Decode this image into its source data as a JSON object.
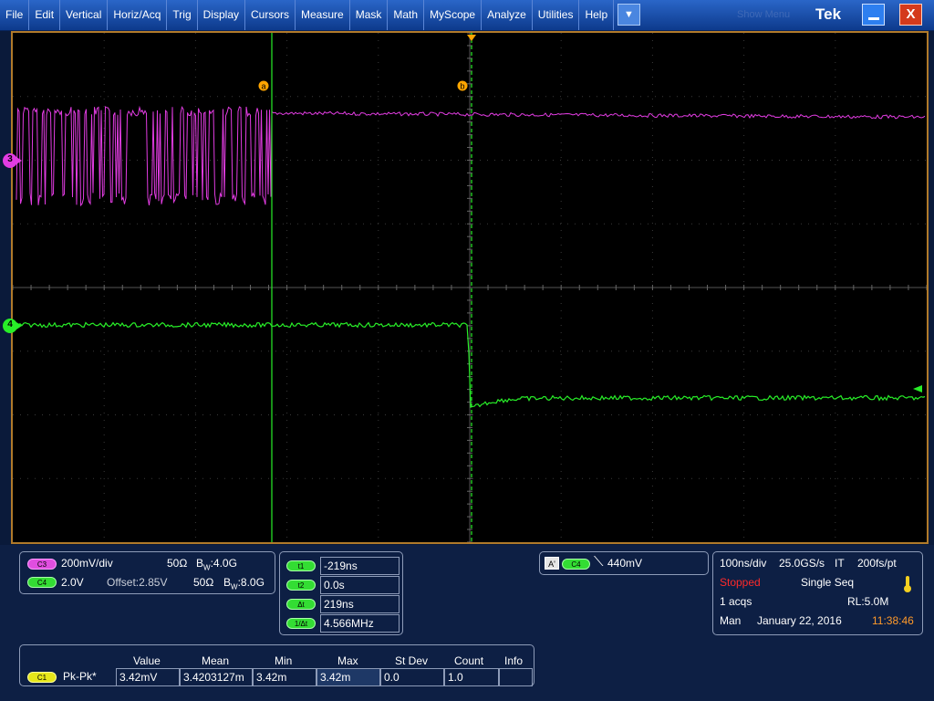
{
  "menu": [
    "File",
    "Edit",
    "Vertical",
    "Horiz/Acq",
    "Trig",
    "Display",
    "Cursors",
    "Measure",
    "Mask",
    "Math",
    "MyScope",
    "Analyze",
    "Utilities",
    "Help"
  ],
  "title": {
    "dropdown_glyph": "▼",
    "ghost": "Show Menu",
    "brand": "Tek",
    "minimize_glyph": "_",
    "close_glyph": "X"
  },
  "markers": {
    "ch3": "3",
    "ch4": "4",
    "cursor_a": "a",
    "cursor_b": "b"
  },
  "channels": {
    "ch3": {
      "tag": "C3",
      "scale": "200mV/div",
      "impedance": "50Ω",
      "bw_prefix": "B",
      "bw_sub": "W",
      "bw_value": ":4.0G",
      "color": "#e23ce2"
    },
    "ch4": {
      "tag": "C4",
      "scale": "2.0V",
      "offset": "Offset:2.85V",
      "impedance": "50Ω",
      "bw_prefix": "B",
      "bw_sub": "W",
      "bw_value": ":8.0G",
      "color": "#28ee28"
    }
  },
  "cursors": {
    "rows": [
      {
        "tag": "t1",
        "value": "-219ns"
      },
      {
        "tag": "t2",
        "value": "0.0s"
      },
      {
        "tag": "Δt",
        "value": "219ns"
      },
      {
        "tag": "1/Δt",
        "value": "4.566MHz"
      }
    ]
  },
  "trigger": {
    "source_tag": "A'",
    "channel_tag": "C4",
    "slope_glyph": "⟍",
    "level": "440mV"
  },
  "horizontal": {
    "timebase": "100ns/div",
    "sample_rate": "25.0GS/s",
    "mode": "IT",
    "resolution": "200fs/pt",
    "status": "Stopped",
    "acq_mode": "Single Seq",
    "acqs": "1 acqs",
    "record_length": "RL:5.0M",
    "trigger_mode": "Man",
    "date": "January 22, 2016",
    "time": "11:38:46"
  },
  "measurement": {
    "headers": [
      "Value",
      "Mean",
      "Min",
      "Max",
      "St Dev",
      "Count",
      "Info"
    ],
    "row": {
      "source": "C1",
      "name": "Pk-Pk*",
      "value": "3.42mV",
      "mean": "3.4203127m",
      "min": "3.42m",
      "max": "3.42m",
      "stdev": "0.0",
      "count": "1.0",
      "info": ""
    }
  },
  "colors": {
    "ch3": "#e23ce2",
    "ch4": "#28ee28",
    "cursor_marker": "#ffa500",
    "border": "#b07a2a",
    "status_red": "#ff2a2a",
    "time_orange": "#ff9a2a"
  }
}
